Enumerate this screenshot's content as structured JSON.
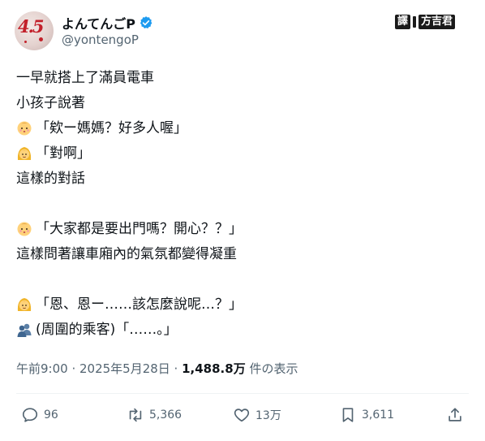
{
  "author": {
    "display_name": "よんてんごP",
    "handle": "@yontengoP",
    "avatar_text": "4.5"
  },
  "watermark": {
    "left": "譯",
    "right": "方吉君"
  },
  "tweet_lines": [
    {
      "emoji": "",
      "text": "一早就搭上了滿員電車"
    },
    {
      "emoji": "",
      "text": "小孩子說著"
    },
    {
      "emoji": "baby-face-icon",
      "text": "「欸ー媽媽？好多人喔」"
    },
    {
      "emoji": "woman-face-icon",
      "text": "「對啊」"
    },
    {
      "emoji": "",
      "text": "這樣的對話"
    },
    {
      "emoji": "baby-face-icon",
      "text": "「大家都是要出門嗎？開心？？」"
    },
    {
      "emoji": "",
      "text": "這樣問著讓車廂內的氣氛都變得凝重"
    },
    {
      "emoji": "woman-face-icon",
      "text": "「恩、恩ー……該怎麼說呢…？」"
    },
    {
      "emoji": "people-silhouette-icon",
      "text": "(周圍的乘客)「……。」"
    }
  ],
  "meta": {
    "timestamp": "午前9:00 · 2025年5月28日 · ",
    "views": "1,488.8万",
    "views_suffix": " 件の表示"
  },
  "actions": {
    "replies": "96",
    "retweets": "5,366",
    "likes": "13万",
    "bookmarks": "3,611"
  },
  "colors": {
    "text": "#0f1419",
    "secondary": "#536471",
    "verified": "#1d9bf0",
    "divider": "#eff3f4"
  }
}
